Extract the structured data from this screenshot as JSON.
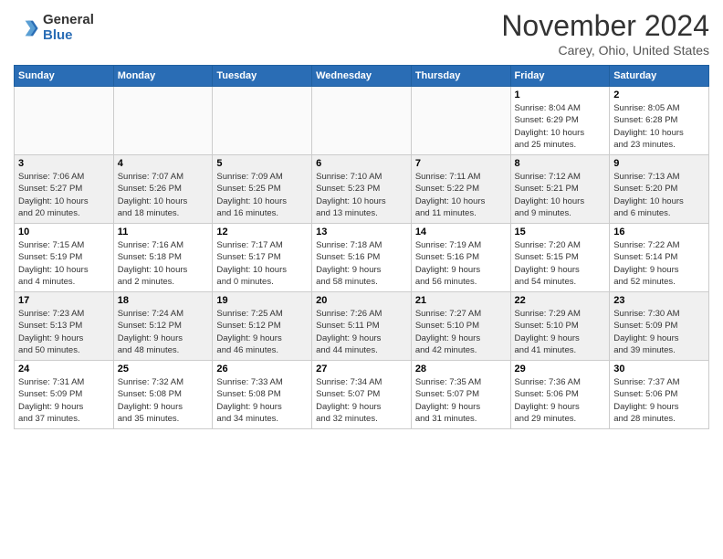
{
  "header": {
    "logo_line1": "General",
    "logo_line2": "Blue",
    "month": "November 2024",
    "location": "Carey, Ohio, United States"
  },
  "weekdays": [
    "Sunday",
    "Monday",
    "Tuesday",
    "Wednesday",
    "Thursday",
    "Friday",
    "Saturday"
  ],
  "weeks": [
    [
      {
        "day": "",
        "info": ""
      },
      {
        "day": "",
        "info": ""
      },
      {
        "day": "",
        "info": ""
      },
      {
        "day": "",
        "info": ""
      },
      {
        "day": "",
        "info": ""
      },
      {
        "day": "1",
        "info": "Sunrise: 8:04 AM\nSunset: 6:29 PM\nDaylight: 10 hours\nand 25 minutes."
      },
      {
        "day": "2",
        "info": "Sunrise: 8:05 AM\nSunset: 6:28 PM\nDaylight: 10 hours\nand 23 minutes."
      }
    ],
    [
      {
        "day": "3",
        "info": "Sunrise: 7:06 AM\nSunset: 5:27 PM\nDaylight: 10 hours\nand 20 minutes."
      },
      {
        "day": "4",
        "info": "Sunrise: 7:07 AM\nSunset: 5:26 PM\nDaylight: 10 hours\nand 18 minutes."
      },
      {
        "day": "5",
        "info": "Sunrise: 7:09 AM\nSunset: 5:25 PM\nDaylight: 10 hours\nand 16 minutes."
      },
      {
        "day": "6",
        "info": "Sunrise: 7:10 AM\nSunset: 5:23 PM\nDaylight: 10 hours\nand 13 minutes."
      },
      {
        "day": "7",
        "info": "Sunrise: 7:11 AM\nSunset: 5:22 PM\nDaylight: 10 hours\nand 11 minutes."
      },
      {
        "day": "8",
        "info": "Sunrise: 7:12 AM\nSunset: 5:21 PM\nDaylight: 10 hours\nand 9 minutes."
      },
      {
        "day": "9",
        "info": "Sunrise: 7:13 AM\nSunset: 5:20 PM\nDaylight: 10 hours\nand 6 minutes."
      }
    ],
    [
      {
        "day": "10",
        "info": "Sunrise: 7:15 AM\nSunset: 5:19 PM\nDaylight: 10 hours\nand 4 minutes."
      },
      {
        "day": "11",
        "info": "Sunrise: 7:16 AM\nSunset: 5:18 PM\nDaylight: 10 hours\nand 2 minutes."
      },
      {
        "day": "12",
        "info": "Sunrise: 7:17 AM\nSunset: 5:17 PM\nDaylight: 10 hours\nand 0 minutes."
      },
      {
        "day": "13",
        "info": "Sunrise: 7:18 AM\nSunset: 5:16 PM\nDaylight: 9 hours\nand 58 minutes."
      },
      {
        "day": "14",
        "info": "Sunrise: 7:19 AM\nSunset: 5:16 PM\nDaylight: 9 hours\nand 56 minutes."
      },
      {
        "day": "15",
        "info": "Sunrise: 7:20 AM\nSunset: 5:15 PM\nDaylight: 9 hours\nand 54 minutes."
      },
      {
        "day": "16",
        "info": "Sunrise: 7:22 AM\nSunset: 5:14 PM\nDaylight: 9 hours\nand 52 minutes."
      }
    ],
    [
      {
        "day": "17",
        "info": "Sunrise: 7:23 AM\nSunset: 5:13 PM\nDaylight: 9 hours\nand 50 minutes."
      },
      {
        "day": "18",
        "info": "Sunrise: 7:24 AM\nSunset: 5:12 PM\nDaylight: 9 hours\nand 48 minutes."
      },
      {
        "day": "19",
        "info": "Sunrise: 7:25 AM\nSunset: 5:12 PM\nDaylight: 9 hours\nand 46 minutes."
      },
      {
        "day": "20",
        "info": "Sunrise: 7:26 AM\nSunset: 5:11 PM\nDaylight: 9 hours\nand 44 minutes."
      },
      {
        "day": "21",
        "info": "Sunrise: 7:27 AM\nSunset: 5:10 PM\nDaylight: 9 hours\nand 42 minutes."
      },
      {
        "day": "22",
        "info": "Sunrise: 7:29 AM\nSunset: 5:10 PM\nDaylight: 9 hours\nand 41 minutes."
      },
      {
        "day": "23",
        "info": "Sunrise: 7:30 AM\nSunset: 5:09 PM\nDaylight: 9 hours\nand 39 minutes."
      }
    ],
    [
      {
        "day": "24",
        "info": "Sunrise: 7:31 AM\nSunset: 5:09 PM\nDaylight: 9 hours\nand 37 minutes."
      },
      {
        "day": "25",
        "info": "Sunrise: 7:32 AM\nSunset: 5:08 PM\nDaylight: 9 hours\nand 35 minutes."
      },
      {
        "day": "26",
        "info": "Sunrise: 7:33 AM\nSunset: 5:08 PM\nDaylight: 9 hours\nand 34 minutes."
      },
      {
        "day": "27",
        "info": "Sunrise: 7:34 AM\nSunset: 5:07 PM\nDaylight: 9 hours\nand 32 minutes."
      },
      {
        "day": "28",
        "info": "Sunrise: 7:35 AM\nSunset: 5:07 PM\nDaylight: 9 hours\nand 31 minutes."
      },
      {
        "day": "29",
        "info": "Sunrise: 7:36 AM\nSunset: 5:06 PM\nDaylight: 9 hours\nand 29 minutes."
      },
      {
        "day": "30",
        "info": "Sunrise: 7:37 AM\nSunset: 5:06 PM\nDaylight: 9 hours\nand 28 minutes."
      }
    ]
  ]
}
